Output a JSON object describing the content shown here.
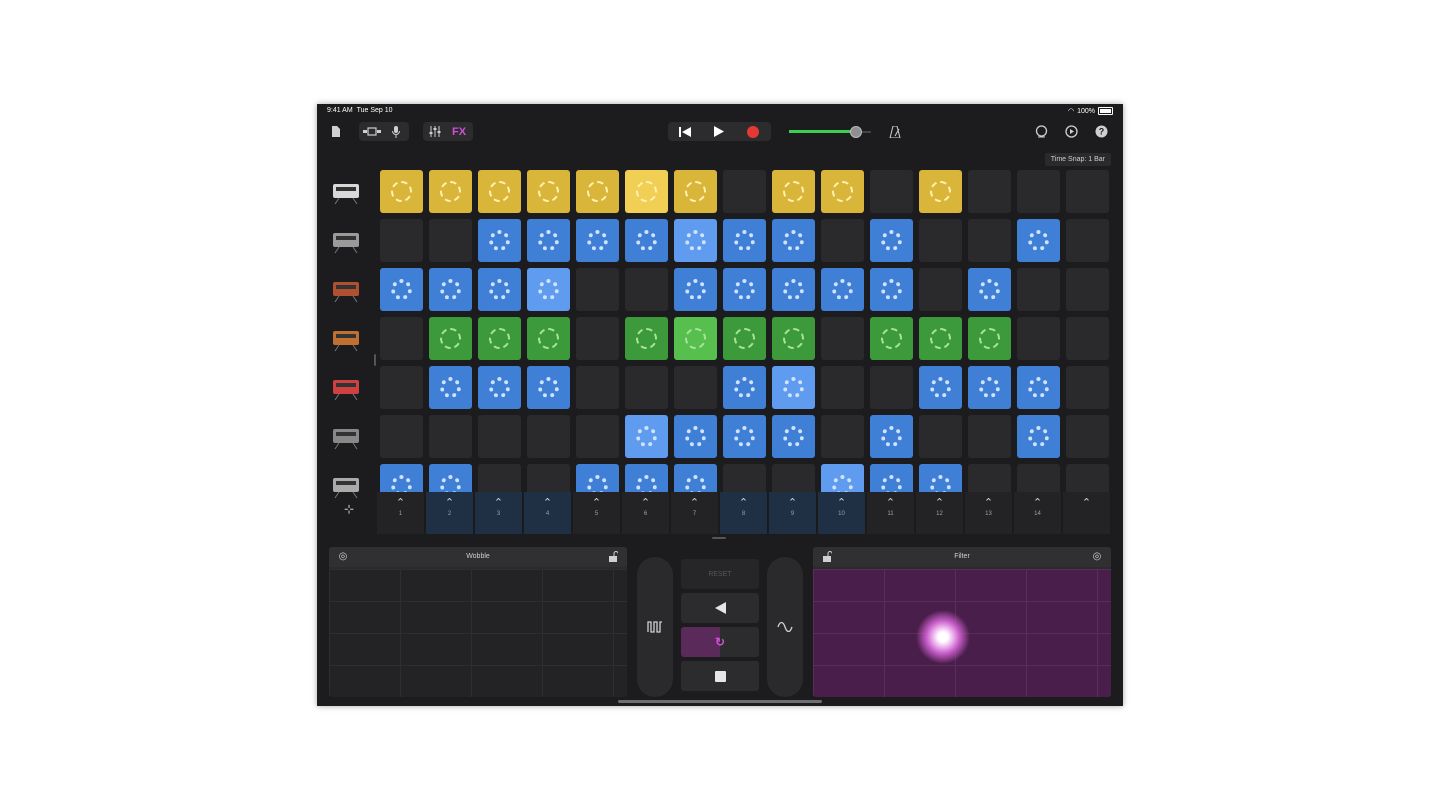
{
  "status": {
    "time": "9:41 AM",
    "date": "Tue Sep 10",
    "battery": "100%"
  },
  "toolbar": {
    "fx_label": "FX",
    "time_snap": "Time Snap: 1 Bar",
    "volume_level": 0.82,
    "accent_play": "#d14fd6",
    "record_color": "#e53935"
  },
  "instruments": [
    "drum-machine",
    "turntable",
    "synth-keyboard",
    "analog-synth",
    "keyboard",
    "bass-speaker",
    "keyboard-stand"
  ],
  "grid": {
    "rows": [
      {
        "color": "yellow",
        "cells": [
          1,
          1,
          1,
          1,
          1,
          2,
          1,
          0,
          1,
          1,
          0,
          1,
          0,
          0,
          0
        ]
      },
      {
        "color": "blue",
        "cells": [
          0,
          0,
          1,
          1,
          1,
          1,
          2,
          1,
          1,
          0,
          1,
          0,
          0,
          1,
          0
        ]
      },
      {
        "color": "blue",
        "cells": [
          1,
          1,
          1,
          2,
          0,
          0,
          1,
          1,
          1,
          1,
          1,
          0,
          1,
          0,
          0
        ]
      },
      {
        "color": "green",
        "cells": [
          0,
          1,
          1,
          1,
          0,
          1,
          2,
          1,
          1,
          0,
          1,
          1,
          1,
          0,
          0
        ]
      },
      {
        "color": "blue",
        "cells": [
          0,
          1,
          1,
          1,
          0,
          0,
          0,
          1,
          2,
          0,
          0,
          1,
          1,
          1,
          0
        ]
      },
      {
        "color": "blue",
        "cells": [
          0,
          0,
          0,
          0,
          0,
          2,
          1,
          1,
          1,
          0,
          1,
          0,
          0,
          1,
          0
        ]
      },
      {
        "color": "blue",
        "cells": [
          1,
          1,
          0,
          0,
          1,
          1,
          1,
          0,
          0,
          2,
          1,
          1,
          0,
          0,
          0
        ]
      }
    ]
  },
  "triggers": [
    {
      "label": "1",
      "active": false
    },
    {
      "label": "2",
      "active": true
    },
    {
      "label": "3",
      "active": true
    },
    {
      "label": "4",
      "active": true
    },
    {
      "label": "5",
      "active": false
    },
    {
      "label": "6",
      "active": false
    },
    {
      "label": "7",
      "active": false
    },
    {
      "label": "8",
      "active": true
    },
    {
      "label": "9",
      "active": true
    },
    {
      "label": "10",
      "active": true
    },
    {
      "label": "11",
      "active": false
    },
    {
      "label": "12",
      "active": false
    },
    {
      "label": "13",
      "active": false
    },
    {
      "label": "14",
      "active": false
    },
    {
      "label": "",
      "active": false
    }
  ],
  "fx": {
    "left_pad": "Wobble",
    "right_pad": "Filter",
    "reset_label": "RESET"
  }
}
